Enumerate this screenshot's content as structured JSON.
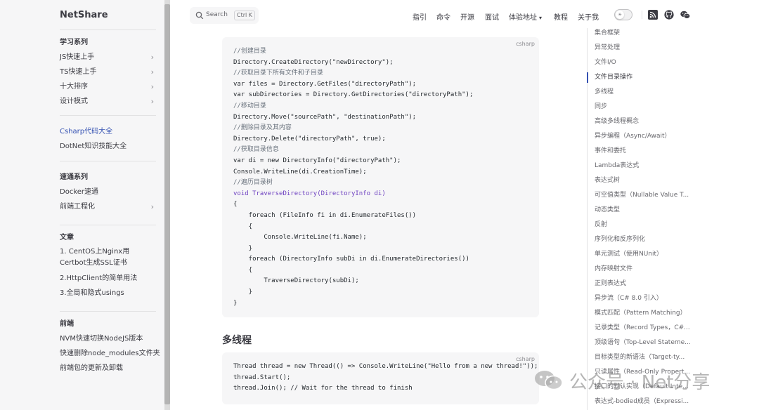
{
  "site": {
    "title": "NetShare"
  },
  "search": {
    "label": "Search",
    "shortcut": "Ctrl K"
  },
  "topnav": [
    "指引",
    "命令",
    "开源",
    "面试",
    "体验地址",
    "教程",
    "关于我"
  ],
  "sidebar": {
    "groups": [
      {
        "title": "学习系列",
        "items": [
          {
            "label": "JS快速上手",
            "expandable": true
          },
          {
            "label": "TS快速上手",
            "expandable": true
          },
          {
            "label": "十大排序",
            "expandable": true
          },
          {
            "label": "设计模式",
            "expandable": true
          }
        ]
      },
      {
        "title": "",
        "items": [
          {
            "label": "Csharp代码大全",
            "active": true
          },
          {
            "label": "DotNet知识技能大全"
          }
        ]
      },
      {
        "title": "速通系列",
        "items": [
          {
            "label": "Docker速通"
          },
          {
            "label": "前端工程化",
            "expandable": true
          }
        ]
      },
      {
        "title": "文章",
        "items": [
          {
            "label": "1. CentOS上Nginx用Certbot生成SSL证书"
          },
          {
            "label": "2.HttpClient的简单用法"
          },
          {
            "label": "3.全局和隐式usings"
          }
        ]
      },
      {
        "title": "前端",
        "items": [
          {
            "label": "NVM快速切换NodeJS版本"
          },
          {
            "label": "快速删除node_modules文件夹"
          },
          {
            "label": "前端包的更新及卸载"
          }
        ]
      }
    ]
  },
  "content": {
    "code1_lang": "csharp",
    "code1": [
      "//创建目录",
      "Directory.CreateDirectory(\"newDirectory\");",
      "//获取目录下所有文件和子目录",
      "var files = Directory.GetFiles(\"directoryPath\");",
      "var subDirectories = Directory.GetDirectories(\"directoryPath\");",
      "//移动目录",
      "Directory.Move(\"sourcePath\", \"destinationPath\");",
      "//删除目录及其内容",
      "Directory.Delete(\"directoryPath\", true);",
      "//获取目录信息",
      "var di = new DirectoryInfo(\"directoryPath\");",
      "Console.WriteLine(di.CreationTime);",
      "//遍历目录树",
      "void TraverseDirectory(DirectoryInfo di)",
      "{",
      "    foreach (FileInfo fi in di.EnumerateFiles())",
      "    {",
      "        Console.WriteLine(fi.Name);",
      "    }",
      "    foreach (DirectoryInfo subDi in di.EnumerateDirectories())",
      "    {",
      "        TraverseDirectory(subDi);",
      "    }",
      "}"
    ],
    "heading": "多线程",
    "code2_lang": "csharp",
    "code2": [
      "Thread thread = new Thread(() => Console.WriteLine(\"Hello from a new thread!\"));",
      "thread.Start();",
      "thread.Join(); // Wait for the thread to finish"
    ]
  },
  "outline": {
    "active_index": 3,
    "items": [
      "集合框架",
      "异常处理",
      "文件I/O",
      "文件目录操作",
      "多线程",
      "同步",
      "高级多线程概念",
      "异步编程（Async/Await）",
      "事件和委托",
      "Lambda表达式",
      "表达式树",
      "可空值类型（Nullable Value T...",
      "动态类型",
      "反射",
      "序列化和反序列化",
      "单元测试（使用NUnit）",
      "内存映射文件",
      "正则表达式",
      "异步流（C# 8.0 引入）",
      "模式匹配（Pattern Matching）",
      "记录类型（Record Types，C#...",
      "顶级语句（Top-Level Stateme...",
      "目标类型的新语法（Target-ty...",
      "只读属性（Read-Only Propert...",
      "接口的默认实现（Default Inte...",
      "表达式-bodied成员（Expressi..."
    ]
  },
  "watermark": {
    "text": "公众号 · Net分享"
  },
  "colors": {
    "brand": "#3451b2",
    "sidebar_bg": "#f6f6f7",
    "code_bg": "#f6f6f7"
  }
}
